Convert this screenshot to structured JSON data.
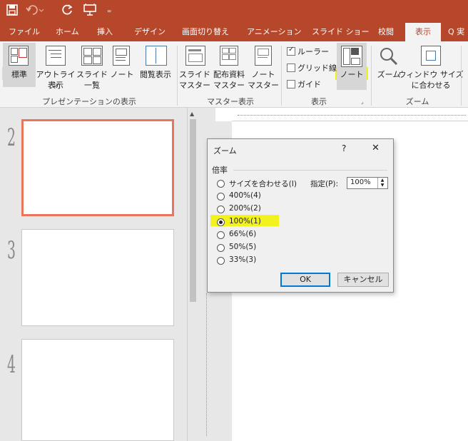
{
  "qat": {
    "save_icon": "save-icon",
    "undo_icon": "undo-icon",
    "redo_icon": "redo-icon",
    "present_icon": "present-from-start-icon",
    "more": "₌"
  },
  "tabs": [
    {
      "label": "ファイル"
    },
    {
      "label": "ホーム"
    },
    {
      "label": "挿入"
    },
    {
      "label": "デザイン"
    },
    {
      "label": "画面切り替え"
    },
    {
      "label": "アニメーション"
    },
    {
      "label": "スライド ショー"
    },
    {
      "label": "校閲"
    },
    {
      "label": "表示",
      "active": true
    },
    {
      "label": "Q 実"
    }
  ],
  "ribbon": {
    "pres_views": {
      "label": "プレゼンテーションの表示",
      "normal": "標準",
      "outline_1": "アウトライン",
      "outline_2": "表示",
      "sorter_1": "スライド",
      "sorter_2": "一覧",
      "notes": "ノート",
      "reading": "閲覧表示"
    },
    "master_views": {
      "label": "マスター表示",
      "slide_1": "スライド",
      "slide_2": "マスター",
      "handout_1": "配布資料",
      "handout_2": "マスター",
      "notes_1": "ノート",
      "notes_2": "マスター"
    },
    "show": {
      "label": "表示",
      "ruler": "ルーラー",
      "ruler_checked": true,
      "grid": "グリッド線",
      "grid_checked": false,
      "guides": "ガイド",
      "guides_checked": false,
      "notes": "ノート"
    },
    "zoom": {
      "label": "ズーム",
      "zoom": "ズーム",
      "fit_1": "ウィンドウ サイズ",
      "fit_2": "に合わせる"
    },
    "highlight_color": "#f2f21e"
  },
  "thumbnails": [
    {
      "number": "2",
      "selected": true
    },
    {
      "number": "3"
    },
    {
      "number": "4"
    }
  ],
  "dialog": {
    "title": "ズーム",
    "help": "?",
    "close": "✕",
    "group": "倍率",
    "options": [
      {
        "label": "サイズを合わせる(I)",
        "selected": false
      },
      {
        "label": "400%(4)",
        "selected": false
      },
      {
        "label": "200%(2)",
        "selected": false
      },
      {
        "label": "100%(1)",
        "selected": true
      },
      {
        "label": "66%(6)",
        "selected": false
      },
      {
        "label": "50%(5)",
        "selected": false
      },
      {
        "label": "33%(3)",
        "selected": false
      }
    ],
    "custom_label": "指定(P):",
    "custom_value": "100%",
    "ok": "OK",
    "cancel": "キャンセル"
  },
  "colors": {
    "accent": "#b7472a",
    "selected_border": "#e8765c"
  }
}
